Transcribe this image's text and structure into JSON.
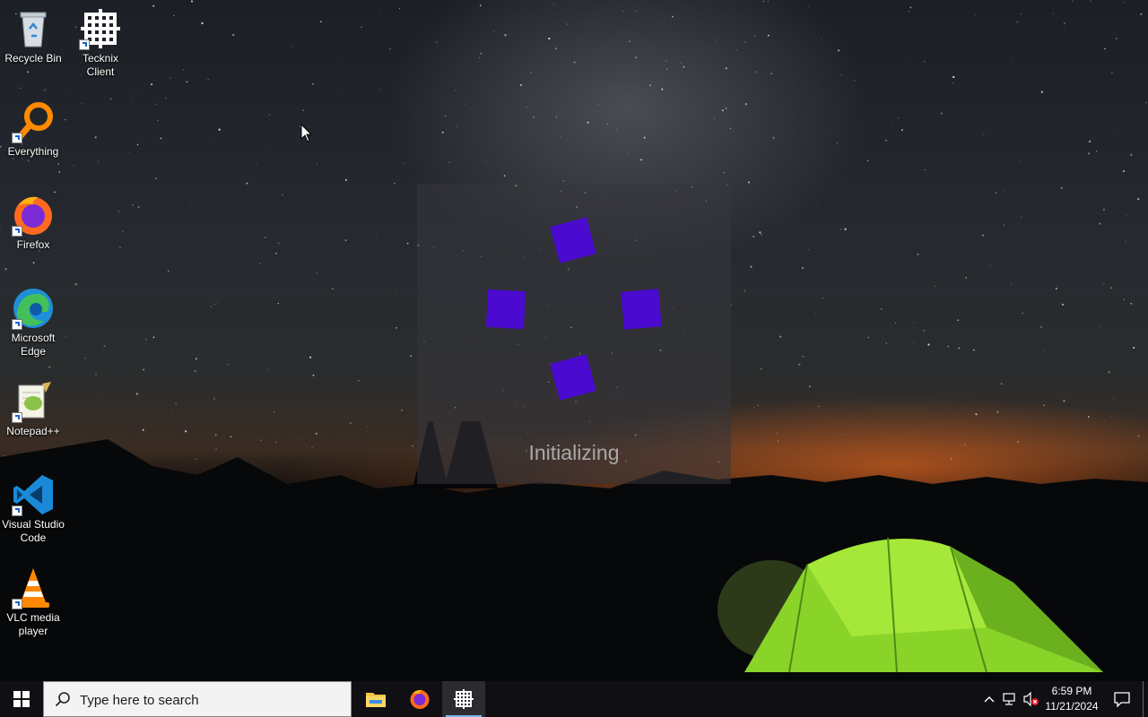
{
  "desktop": {
    "icons": [
      {
        "label": "Recycle Bin",
        "icon": "recycle-bin-icon"
      },
      {
        "label": "Tecknix Client",
        "icon": "tecknix-client-icon"
      },
      {
        "label": "Everything",
        "icon": "everything-search-icon"
      },
      {
        "label": "Firefox",
        "icon": "firefox-icon"
      },
      {
        "label": "Microsoft Edge",
        "icon": "edge-icon"
      },
      {
        "label": "Notepad++",
        "icon": "notepadpp-icon"
      },
      {
        "label": "Visual Studio Code",
        "icon": "vscode-icon"
      },
      {
        "label": "VLC media player",
        "icon": "vlc-icon"
      }
    ]
  },
  "splash": {
    "status": "Initializing",
    "accent": "#4a0ad0"
  },
  "taskbar": {
    "search_placeholder": "Type here to search",
    "pinned": [
      "file-explorer-icon",
      "firefox-icon",
      "tecknix-client-icon"
    ],
    "active_app": "tecknix-client-icon",
    "clock": {
      "time": "6:59 PM",
      "date": "11/21/2024"
    },
    "tray_icons": [
      "chevron-up-icon",
      "network-icon",
      "volume-muted-icon",
      "notification-icon"
    ]
  },
  "colors": {
    "taskbar": "#101014",
    "active_indicator": "#76b9ed"
  }
}
